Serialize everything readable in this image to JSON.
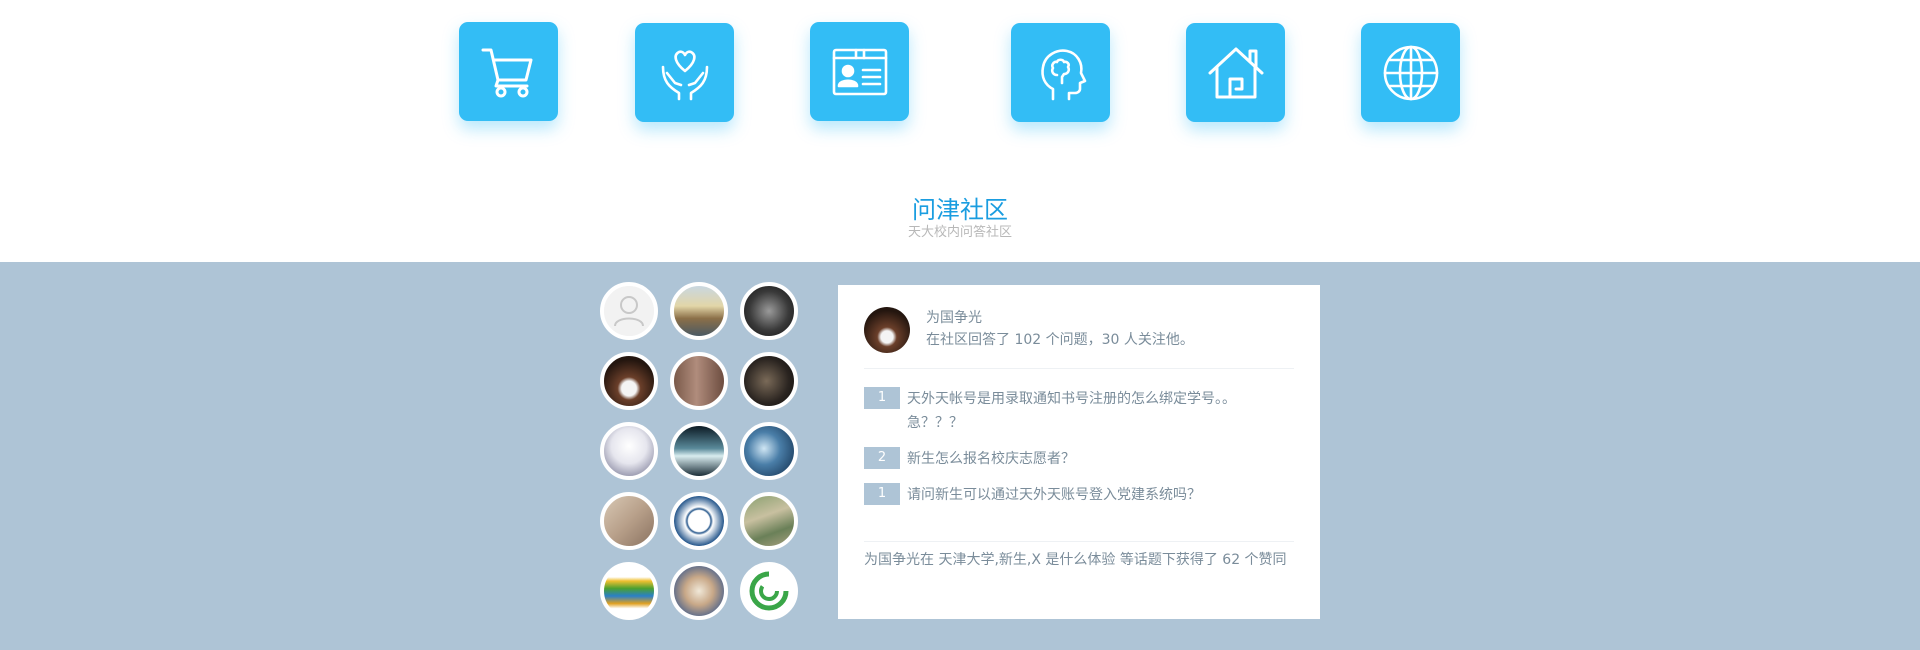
{
  "icons": [
    {
      "name": "shopping-cart-icon"
    },
    {
      "name": "heart-in-hands-icon"
    },
    {
      "name": "id-card-icon"
    },
    {
      "name": "head-brain-icon"
    },
    {
      "name": "home-icon"
    },
    {
      "name": "globe-icon"
    }
  ],
  "section": {
    "title": "问津社区",
    "subtitle": "天大校内问答社区"
  },
  "avatars": [
    {
      "name": "avatar-default"
    },
    {
      "name": "avatar-landscape"
    },
    {
      "name": "avatar-spurs-logo"
    },
    {
      "name": "avatar-basketball-player"
    },
    {
      "name": "avatar-door"
    },
    {
      "name": "avatar-dark-photo"
    },
    {
      "name": "avatar-anime-character"
    },
    {
      "name": "avatar-mountain"
    },
    {
      "name": "avatar-blue-abstract"
    },
    {
      "name": "avatar-sculpture"
    },
    {
      "name": "avatar-university-seal"
    },
    {
      "name": "avatar-aerial-campus"
    },
    {
      "name": "avatar-books"
    },
    {
      "name": "avatar-cartoon-group"
    },
    {
      "name": "avatar-green-circle-logo"
    }
  ],
  "card": {
    "user_name": "为国争光",
    "user_desc": "在社区回答了 102 个问题，30 人关注他。",
    "questions": [
      {
        "count": "1",
        "text": "天外天帐号是用录取通知书号注册的怎么绑定学号。。急？？？"
      },
      {
        "count": "2",
        "text": "新生怎么报名校庆志愿者？"
      },
      {
        "count": "1",
        "text": "请问新生可以通过天外天账号登入党建系统吗？"
      }
    ],
    "footer": "为国争光在 天津大学,新生,X 是什么体验 等话题下获得了 62 个赞同"
  }
}
